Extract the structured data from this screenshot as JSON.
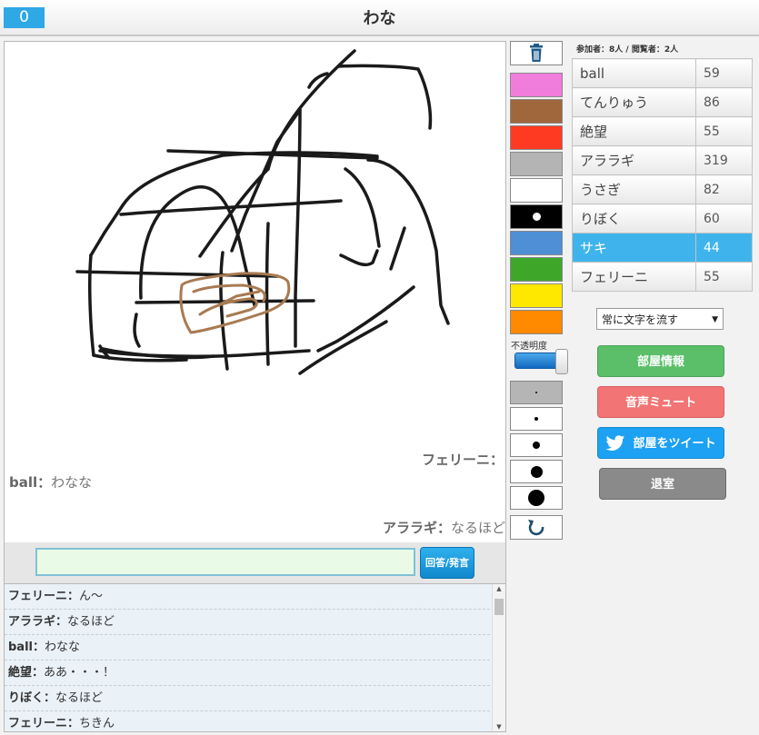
{
  "header": {
    "score": "0",
    "title": "わな"
  },
  "canvas_messages": [
    {
      "name": "フェリーニ",
      "sep": "：",
      "text": ""
    },
    {
      "name": "ball",
      "sep": "：",
      "text": "わなな"
    },
    {
      "name": "アララギ",
      "sep": "：",
      "text": "なるほど"
    }
  ],
  "input": {
    "value": "",
    "answer_label": "回答/発言"
  },
  "chat": [
    {
      "name": "フェリーニ",
      "sep": "：",
      "text": "ん〜"
    },
    {
      "name": "アララギ",
      "sep": "：",
      "text": "なるほど"
    },
    {
      "name": "ball",
      "sep": "：",
      "text": "わなな"
    },
    {
      "name": "絶望",
      "sep": "：",
      "text": "ああ・・・！"
    },
    {
      "name": "りぼく",
      "sep": "：",
      "text": "なるほど"
    },
    {
      "name": "フェリーニ",
      "sep": "：",
      "text": "ちきん"
    }
  ],
  "tools": {
    "colors": [
      "#f07ddc",
      "#a0663c",
      "#ff3a22",
      "#b4b4b4",
      "#ffffff",
      "#000000",
      "#4e8fd6",
      "#3ea72a",
      "#ffe800",
      "#ff8a00"
    ],
    "opacity_label": "不透明度",
    "opacity_value": 1.0,
    "sizes": [
      2,
      4,
      8,
      13,
      18
    ]
  },
  "stats": {
    "text": "参加者：8人 / 閲覧者：2人"
  },
  "players": [
    {
      "name": "ball",
      "score": "59"
    },
    {
      "name": "てんりゅう",
      "score": "86"
    },
    {
      "name": "絶望",
      "score": "55"
    },
    {
      "name": "アララギ",
      "score": "319"
    },
    {
      "name": "うさぎ",
      "score": "82"
    },
    {
      "name": "りぼく",
      "score": "60"
    },
    {
      "name": "サキ",
      "score": "44",
      "active": true
    },
    {
      "name": "フェリーニ",
      "score": "55"
    }
  ],
  "settings": {
    "flow_option": "常に文字を流す"
  },
  "buttons": {
    "room_info": "部屋情報",
    "mute": "音声ミュート",
    "tweet": "部屋をツイート",
    "leave": "退室"
  }
}
